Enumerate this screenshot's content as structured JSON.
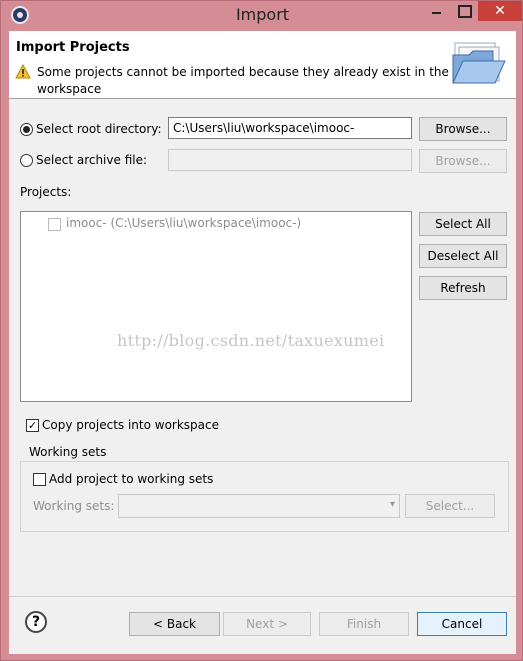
{
  "window": {
    "title": "Import",
    "close_glyph": "✕"
  },
  "header": {
    "title": "Import Projects",
    "message": "Some projects cannot be imported because they already exist in the workspace",
    "icons": {
      "warning": "warning-icon",
      "banner": "folder-icon"
    }
  },
  "source": {
    "root_label": "Select root directory:",
    "root_value": "C:\\Users\\liu\\workspace\\imooc-",
    "root_browse": "Browse...",
    "archive_label": "Select archive file:",
    "archive_value": "",
    "archive_browse": "Browse..."
  },
  "projects": {
    "label": "Projects:",
    "items": [
      {
        "label": "imooc- (C:\\Users\\liu\\workspace\\imooc-)",
        "checked": false,
        "disabled": true
      }
    ],
    "select_all": "Select All",
    "deselect_all": "Deselect All",
    "refresh": "Refresh"
  },
  "watermark": "http://blog.csdn.net/taxuexumei",
  "options": {
    "copy_label": "Copy projects into workspace",
    "copy_checked": true,
    "copy_mark": "✓"
  },
  "working_sets": {
    "group_title": "Working sets",
    "add_label": "Add project to working sets",
    "sets_label": "Working sets:",
    "select_button": "Select...",
    "dropdown_arrow": "▾"
  },
  "footer": {
    "help_glyph": "?",
    "back": "< Back",
    "next": "Next >",
    "finish": "Finish",
    "cancel": "Cancel"
  },
  "colors": {
    "window_frame": "#d48c95",
    "close_button": "#c7413a",
    "dialog_background": "#f0f0f0",
    "disabled_text": "#8c8c8c"
  }
}
